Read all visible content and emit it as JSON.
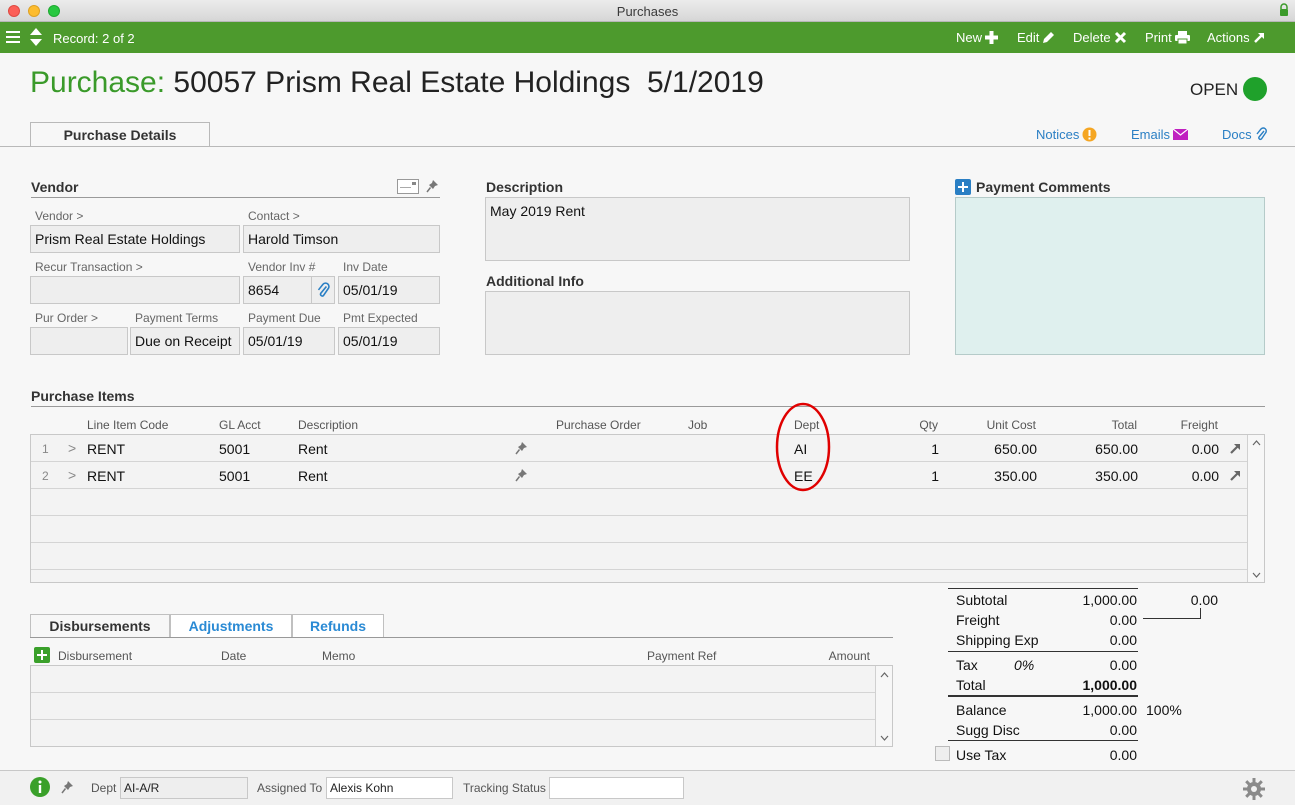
{
  "window": {
    "title": "Purchases"
  },
  "toolbar": {
    "record": "Record: 2 of 2",
    "new": "New",
    "edit": "Edit",
    "delete": "Delete",
    "print": "Print",
    "actions": "Actions"
  },
  "header": {
    "label": "Purchase:",
    "title": "50057 Prism Real Estate Holdings  5/1/2019",
    "status": "OPEN"
  },
  "tabs": {
    "details": "Purchase Details",
    "notices": "Notices",
    "emails": "Emails",
    "docs": "Docs"
  },
  "vendor": {
    "section": "Vendor",
    "vendor_label": "Vendor >",
    "vendor": "Prism Real Estate Holdings",
    "contact_label": "Contact >",
    "contact": "Harold Timson",
    "recur_label": "Recur Transaction >",
    "recur": "",
    "vendor_inv_label": "Vendor Inv #",
    "vendor_inv": "8654",
    "inv_date_label": "Inv Date",
    "inv_date": "05/01/19",
    "pur_order_label": "Pur Order >",
    "pur_order": "",
    "terms_label": "Payment Terms",
    "terms": "Due on Receipt",
    "due_label": "Payment Due",
    "due": "05/01/19",
    "expected_label": "Pmt Expected",
    "expected": "05/01/19"
  },
  "description": {
    "section": "Description",
    "value": "May 2019 Rent",
    "addl_section": "Additional Info",
    "addl_value": ""
  },
  "payment_comments": {
    "section": "Payment Comments",
    "value": ""
  },
  "items": {
    "section": "Purchase Items",
    "columns": {
      "code": "Line Item Code",
      "gl": "GL Acct",
      "desc": "Description",
      "po": "Purchase Order",
      "job": "Job",
      "dept": "Dept",
      "qty": "Qty",
      "unit": "Unit Cost",
      "total": "Total",
      "freight": "Freight"
    },
    "rows": [
      {
        "n": "1",
        "arrow": ">",
        "code": "RENT",
        "gl": "5001",
        "desc": "Rent",
        "po": "",
        "job": "",
        "dept": "AI",
        "qty": "1",
        "unit": "650.00",
        "total": "650.00",
        "freight": "0.00"
      },
      {
        "n": "2",
        "arrow": ">",
        "code": "RENT",
        "gl": "5001",
        "desc": "Rent",
        "po": "",
        "job": "",
        "dept": "EE",
        "qty": "1",
        "unit": "350.00",
        "total": "350.00",
        "freight": "0.00"
      }
    ]
  },
  "disb": {
    "tabs": [
      "Disbursements",
      "Adjustments",
      "Refunds"
    ],
    "columns": {
      "disbursement": "Disbursement",
      "date": "Date",
      "memo": "Memo",
      "ref": "Payment Ref",
      "amount": "Amount"
    }
  },
  "totals": {
    "subtotal_label": "Subtotal",
    "subtotal": "1,000.00",
    "freight_side": "0.00",
    "freight_label": "Freight",
    "freight": "0.00",
    "shipping_label": "Shipping Exp",
    "shipping": "0.00",
    "tax_label": "Tax",
    "tax_pct": "0%",
    "tax": "0.00",
    "total_label": "Total",
    "total": "1,000.00",
    "balance_label": "Balance",
    "balance": "1,000.00",
    "balance_pct": "100%",
    "sugg_label": "Sugg Disc",
    "sugg": "0.00",
    "usetax_label": "Use Tax",
    "usetax": "0.00"
  },
  "footer": {
    "dept_label": "Dept",
    "dept": "AI-A/R",
    "assigned_label": "Assigned To",
    "assigned": "Alexis Kohn",
    "tracking_label": "Tracking Status",
    "tracking": ""
  }
}
